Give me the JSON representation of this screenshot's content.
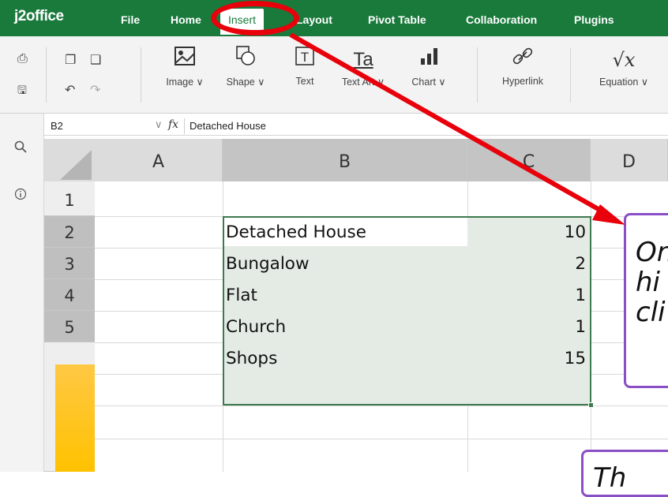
{
  "app": {
    "logo": "j2office",
    "menu": [
      "File",
      "Home",
      "Insert",
      "Layout",
      "Pivot Table",
      "Collaboration",
      "Plugins"
    ],
    "active_menu": "Insert"
  },
  "ribbon": {
    "tools": [
      {
        "label": "Image ∨",
        "icon": "image-icon"
      },
      {
        "label": "Shape ∨",
        "icon": "shape-icon"
      },
      {
        "label": "Text",
        "icon": "text-box-icon"
      },
      {
        "label": "Text Art ∨",
        "icon": "text-art-icon"
      },
      {
        "label": "Chart ∨",
        "icon": "chart-icon"
      },
      {
        "label": "Hyperlink",
        "icon": "hyperlink-icon"
      },
      {
        "label": "Equation ∨",
        "icon": "equation-icon"
      }
    ]
  },
  "formula_bar": {
    "cell_ref": "B2",
    "fx": "fx",
    "value": "Detached House"
  },
  "grid": {
    "columns": [
      "A",
      "B",
      "C",
      "D"
    ],
    "rows": [
      "1",
      "2",
      "3",
      "4",
      "5",
      ""
    ],
    "data": [
      {
        "label": "Detached House",
        "value": "10"
      },
      {
        "label": "Bungalow",
        "value": "2"
      },
      {
        "label": "Flat",
        "value": "1"
      },
      {
        "label": "Church",
        "value": "1"
      },
      {
        "label": "Shops",
        "value": "15"
      }
    ]
  },
  "annotations": {
    "callout1_lines": [
      "On",
      "hi",
      "cli"
    ],
    "callout2_lines": [
      "Th"
    ]
  },
  "colors": {
    "brand_green": "#1a7a3c",
    "highlight_red": "#e8000b",
    "callout_purple": "#8a4fc6",
    "selection_green": "#3e7a4f"
  }
}
